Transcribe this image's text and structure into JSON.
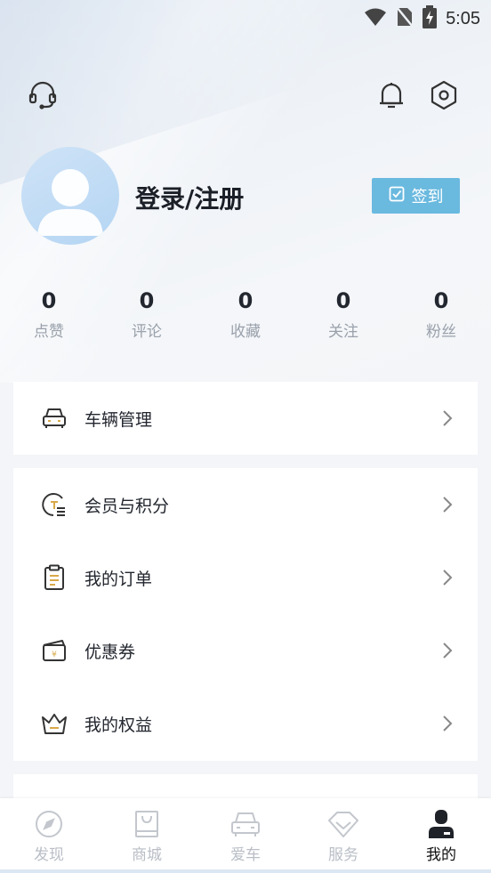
{
  "status_bar": {
    "time": "5:05"
  },
  "profile": {
    "login_label": "登录/注册",
    "checkin_label": "签到"
  },
  "stats": [
    {
      "value": "0",
      "label": "点赞"
    },
    {
      "value": "0",
      "label": "评论"
    },
    {
      "value": "0",
      "label": "收藏"
    },
    {
      "value": "0",
      "label": "关注"
    },
    {
      "value": "0",
      "label": "粉丝"
    }
  ],
  "menu": {
    "vehicle": {
      "label": "车辆管理",
      "icon": "car-icon"
    },
    "items": [
      {
        "label": "会员与积分",
        "icon": "membership-points-icon"
      },
      {
        "label": "我的订单",
        "icon": "order-clipboard-icon"
      },
      {
        "label": "优惠券",
        "icon": "coupon-icon"
      },
      {
        "label": "我的权益",
        "icon": "crown-icon"
      }
    ]
  },
  "bottom_nav": [
    {
      "label": "发现",
      "icon": "compass-icon",
      "active": false
    },
    {
      "label": "商城",
      "icon": "shopping-bag-icon",
      "active": false
    },
    {
      "label": "爱车",
      "icon": "car-icon",
      "active": false
    },
    {
      "label": "服务",
      "icon": "diamond-icon",
      "active": false
    },
    {
      "label": "我的",
      "icon": "user-icon",
      "active": true
    }
  ],
  "colors": {
    "accent": "#6ab9df",
    "gold": "#d8a84a",
    "text": "#22262e",
    "muted": "#9aa1ab"
  }
}
